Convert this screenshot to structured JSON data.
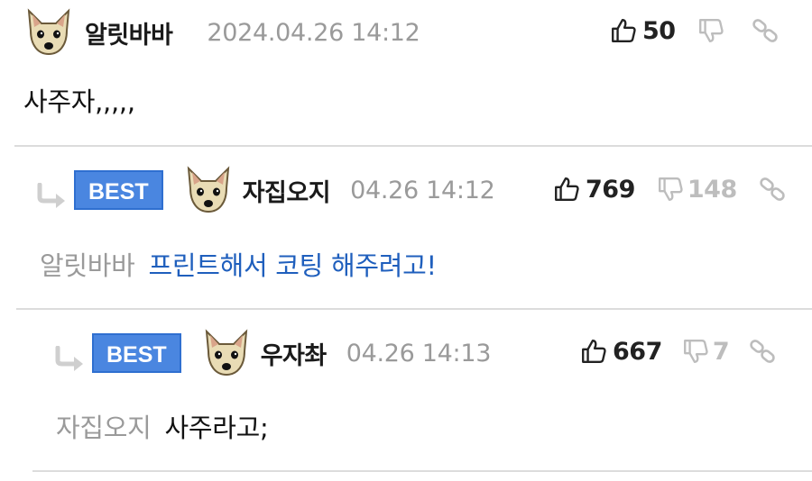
{
  "comments": [
    {
      "nickname": "알릿바바",
      "date": "2024.04.26 14:12",
      "up_count": "50",
      "down_count": "",
      "best": false,
      "reply_to": "",
      "text": "사주자,,,,,"
    },
    {
      "nickname": "자집오지",
      "date": "04.26 14:12",
      "up_count": "769",
      "down_count": "148",
      "best": true,
      "badge": "BEST",
      "reply_to": "알릿바바",
      "text": "프린트해서 코팅 해주려고!"
    },
    {
      "nickname": "우자촤",
      "date": "04.26 14:13",
      "up_count": "667",
      "down_count": "7",
      "best": true,
      "badge": "BEST",
      "reply_to": "자집오지",
      "text": "사주라고;"
    }
  ],
  "icons": {
    "avatar": "dog-avatar-icon",
    "thumbs_up": "thumbs-up-icon",
    "thumbs_down": "thumbs-down-icon",
    "link": "link-icon",
    "reply_arrow": "reply-arrow-icon"
  },
  "colors": {
    "badge": "#4a86e0",
    "reply_text": "#1f5fbd",
    "muted": "#9a9a9a",
    "divider": "#dcdcdc"
  }
}
